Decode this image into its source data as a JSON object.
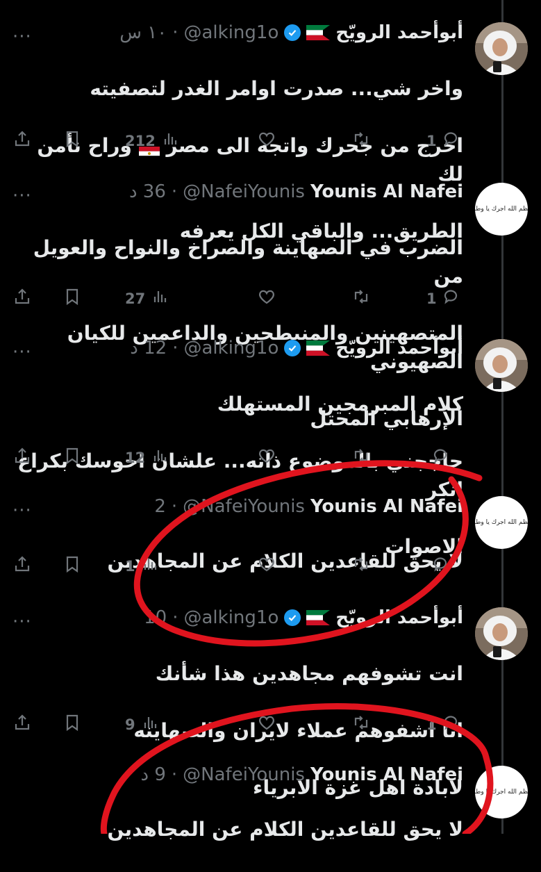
{
  "tweets": [
    {
      "name": "أبوأحمد الرويّح",
      "handle": "@alking1o",
      "time": "١٠ س",
      "verified": true,
      "flag": "kuwait",
      "avatar": "photo",
      "lines": [
        "واخر شي... صدرت اوامر الغدر لتصفيته",
        "اخرج من جحرك واتجه الى مصر 🇪🇬 وراح نأمن لك",
        "الطريق... والباقي الكل يعرفه"
      ],
      "replies": "1",
      "retweets": "",
      "likes": "",
      "views": "212"
    },
    {
      "name": "Younis Al Nafei",
      "handle": "@NafeiYounis",
      "time": "36 د",
      "verified": false,
      "flag": "",
      "avatar": "text",
      "avatar_text": "عظم الله اجرك يا وطن",
      "lines": [
        "الضرب في الصهاينة والصراخ والنواح والعويل من",
        "المتصهينين والمنبطحين والداعمين للكيان الصهيوني",
        "الإرهابي المحتل"
      ],
      "replies": "1",
      "retweets": "",
      "likes": "",
      "views": "27"
    },
    {
      "name": "أبوأحمد الرويّح",
      "handle": "@alking1o",
      "time": "12 د",
      "verified": true,
      "flag": "kuwait",
      "avatar": "photo",
      "lines": [
        "كلام المبرمجين المستهلك",
        "حاججني بالموضوع ذاته... علشان احوسك بكراع انكر",
        "الاصوات"
      ],
      "replies": "",
      "retweets": "",
      "likes": "",
      "views": "12"
    },
    {
      "name": "Younis Al Nafei",
      "handle": "@NafeiYounis",
      "time": "2",
      "verified": false,
      "flag": "",
      "avatar": "text",
      "avatar_text": "عظم الله اجرك يا وطن",
      "lines": [
        "لا يحق للقاعدين الكلام عن المجاهدين"
      ],
      "replies": "",
      "retweets": "",
      "likes": "",
      "views": "1"
    },
    {
      "name": "أبوأحمد الرويّح",
      "handle": "@alking1o",
      "time": "10",
      "verified": true,
      "flag": "kuwait",
      "avatar": "photo",
      "lines": [
        "انت تشوفهم مجاهدين هذا شأنك",
        "انا اشفوهم عملاء لايران والصهاينه",
        "لابادة اهل غزة الابرياء"
      ],
      "replies": "1",
      "retweets": "",
      "likes": "",
      "views": "9"
    },
    {
      "name": "Younis Al Nafei",
      "handle": "@NafeiYounis",
      "time": "9 د",
      "verified": false,
      "flag": "",
      "avatar": "text",
      "avatar_text": "عظم الله اجرك يا وطن",
      "lines": [
        "لا يحق للقاعدين الكلام عن المجاهدين"
      ],
      "replies": "",
      "retweets": "",
      "likes": "",
      "views": ""
    }
  ],
  "more_glyph": "···",
  "colors": {
    "background": "#000000",
    "text": "#e7e9ea",
    "muted": "#71767b",
    "verified": "#1d9bf0",
    "annotation": "#e0141e"
  },
  "icons": [
    "more-icon",
    "verified-icon",
    "kuwait-flag-icon",
    "reply-icon",
    "retweet-icon",
    "like-icon",
    "views-icon",
    "bookmark-icon",
    "share-icon"
  ]
}
